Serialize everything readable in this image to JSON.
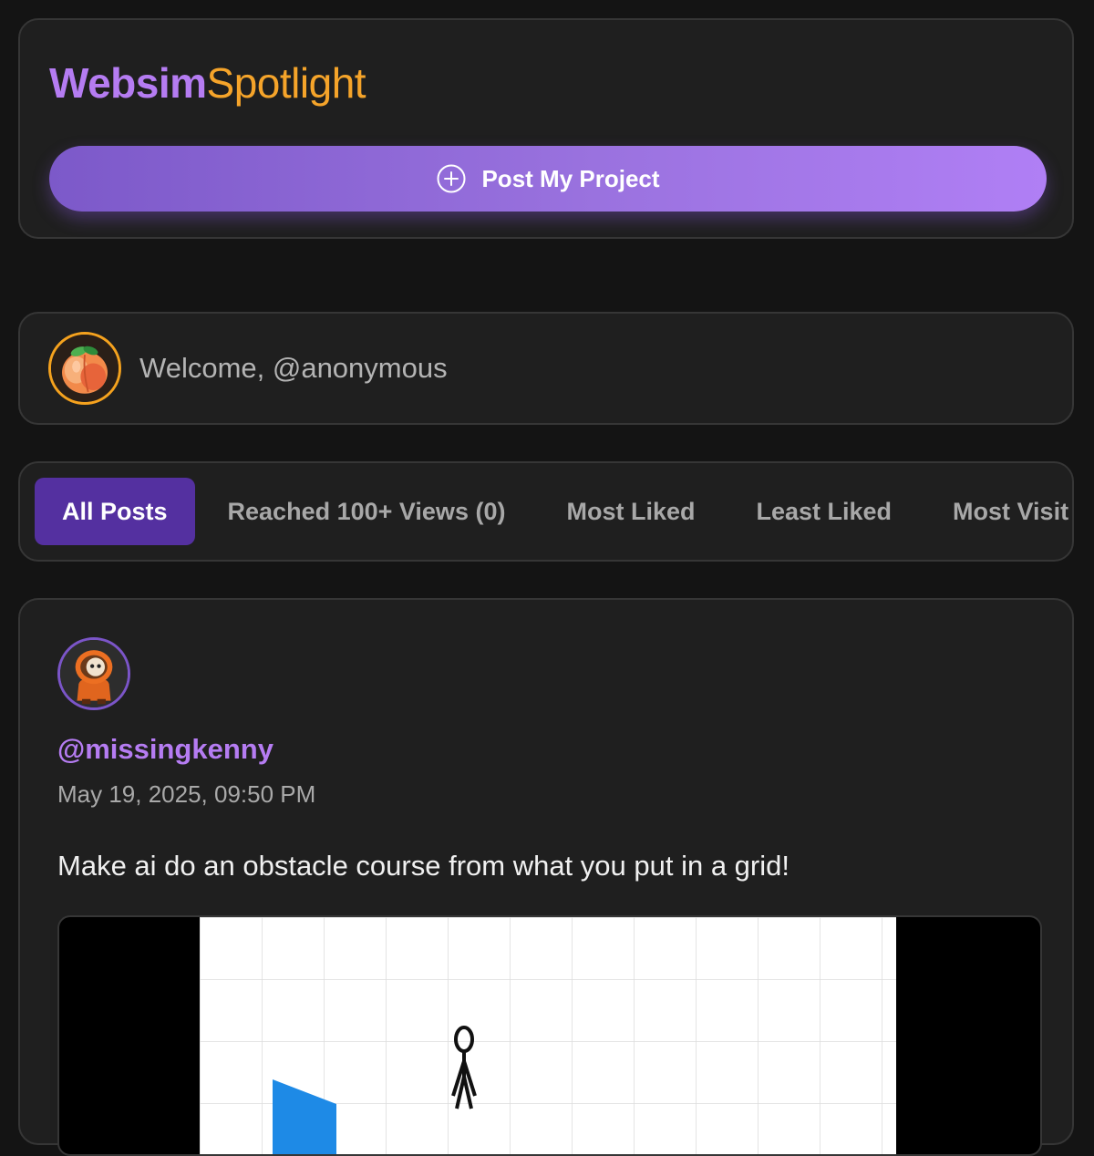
{
  "header": {
    "brand_part1": "Websim",
    "brand_part2": "Spotlight",
    "post_button_label": "Post My Project",
    "post_button_icon": "plus-circle-icon",
    "accent_purple": "#b57cf2",
    "accent_orange": "#f5a42a"
  },
  "welcome": {
    "text": "Welcome, @anonymous",
    "avatar_icon": "peach-icon"
  },
  "tabs": [
    {
      "label": "All Posts",
      "active": true
    },
    {
      "label": "Reached 100+ Views (0)",
      "active": false
    },
    {
      "label": "Most Liked",
      "active": false
    },
    {
      "label": "Least Liked",
      "active": false
    },
    {
      "label": "Most Visit",
      "active": false
    }
  ],
  "post": {
    "username": "@missingkenny",
    "date": "May 19, 2025, 09:50 PM",
    "text": "Make ai do an obstacle course from what you put in a grid!",
    "avatar_icon": "kenny-avatar-icon",
    "media_icon": "grid-preview-image"
  }
}
